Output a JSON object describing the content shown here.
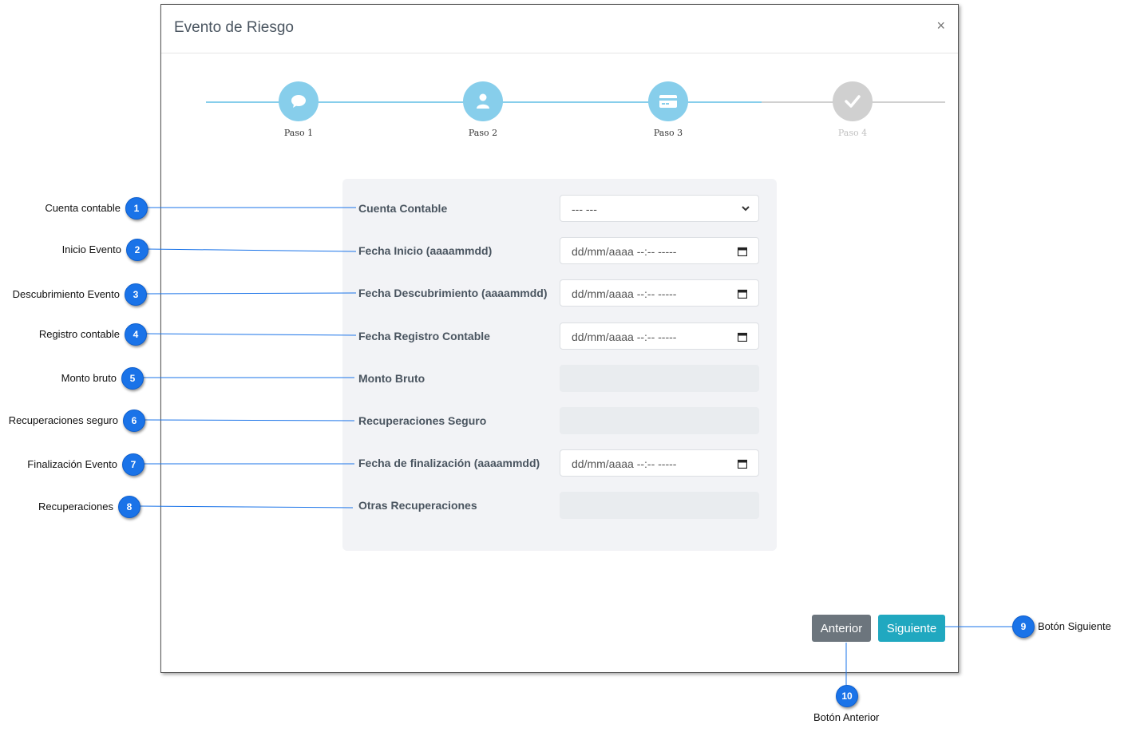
{
  "modal": {
    "title": "Evento de Riesgo",
    "close_label": "×"
  },
  "steps": [
    {
      "label": "Paso 1",
      "icon": "chat-icon",
      "state": "complete"
    },
    {
      "label": "Paso 2",
      "icon": "user-icon",
      "state": "complete"
    },
    {
      "label": "Paso 3",
      "icon": "credit-card-icon",
      "state": "active"
    },
    {
      "label": "Paso 4",
      "icon": "check-icon",
      "state": "inactive"
    }
  ],
  "form": {
    "cuenta_contable": {
      "label": "Cuenta Contable",
      "value": "--- ---"
    },
    "fecha_inicio": {
      "label": "Fecha Inicio (aaaammdd)",
      "placeholder": "dd/mm/aaaa  --:--  -----"
    },
    "fecha_descubrimiento": {
      "label": "Fecha Descubrimiento (aaaammdd)",
      "placeholder": "dd/mm/aaaa  --:--  -----"
    },
    "fecha_registro": {
      "label": "Fecha Registro Contable",
      "placeholder": "dd/mm/aaaa  --:--  -----"
    },
    "monto_bruto": {
      "label": "Monto Bruto",
      "value": ""
    },
    "recuperaciones_seguro": {
      "label": "Recuperaciones Seguro",
      "value": ""
    },
    "fecha_finalizacion": {
      "label": "Fecha de finalización (aaaammdd)",
      "placeholder": "dd/mm/aaaa  --:--  -----"
    },
    "otras_recuperaciones": {
      "label": "Otras Recuperaciones",
      "value": ""
    }
  },
  "buttons": {
    "prev_label": "Anterior",
    "next_label": "Siguiente"
  },
  "callouts": [
    {
      "number": "1",
      "label": "Cuenta contable"
    },
    {
      "number": "2",
      "label": "Inicio Evento"
    },
    {
      "number": "3",
      "label": "Descubrimiento Evento"
    },
    {
      "number": "4",
      "label": "Registro contable"
    },
    {
      "number": "5",
      "label": "Monto bruto"
    },
    {
      "number": "6",
      "label": "Recuperaciones seguro"
    },
    {
      "number": "7",
      "label": "Finalización Evento"
    },
    {
      "number": "8",
      "label": "Recuperaciones"
    },
    {
      "number": "9",
      "label": "Botón Siguiente"
    },
    {
      "number": "10",
      "label": "Botón Anterior"
    }
  ],
  "colors": {
    "step_active": "#87ceeb",
    "step_inactive": "#d0d0d0",
    "callout_badge": "#1a73e8",
    "callout_line": "#1a73e8",
    "btn_prev": "#6c757d",
    "btn_next": "#20a8c0"
  }
}
